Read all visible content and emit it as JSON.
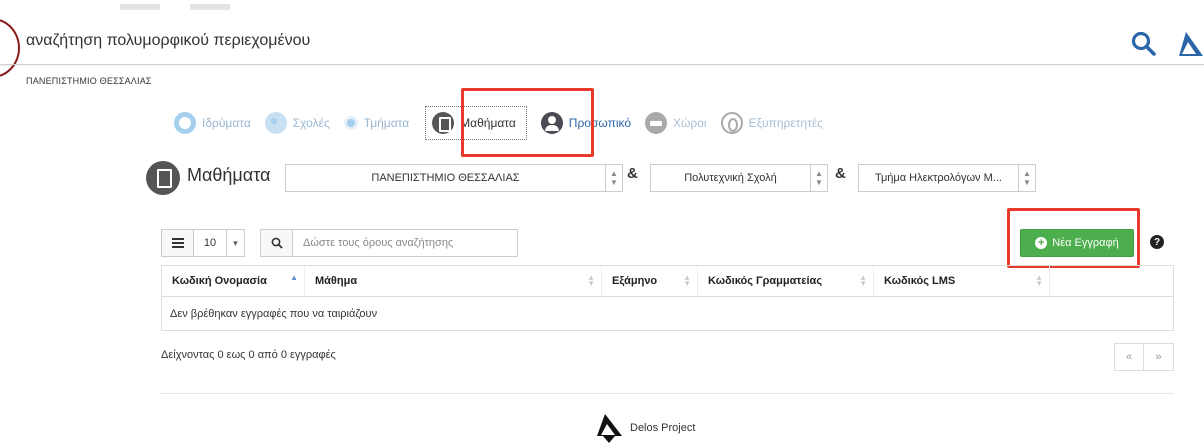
{
  "header": {
    "title": "αναζήτηση πολυμορφικού περιεχομένου",
    "university": "ΠΑΝΕΠΙΣΤΗΜΙΟ ΘΕΣΣΑΛΙΑΣ"
  },
  "nav": {
    "items": [
      {
        "label": "Ιδρύματα",
        "icon": "institution-icon"
      },
      {
        "label": "Σχολές",
        "icon": "school-icon"
      },
      {
        "label": "Τμήματα",
        "icon": "department-icon"
      },
      {
        "label": "Μαθήματα",
        "icon": "book-icon",
        "active": true
      },
      {
        "label": "Προσωπικό",
        "icon": "person-icon"
      },
      {
        "label": "Χώροι",
        "icon": "room-icon"
      },
      {
        "label": "Εξυπηρετητές",
        "icon": "server-icon"
      }
    ]
  },
  "page": {
    "title": "Μαθήματα",
    "filters": {
      "institution": "ΠΑΝΕΠΙΣΤΗΜΙΟ ΘΕΣΣΑΛΙΑΣ",
      "school": "Πολυτεχνική Σχολή",
      "department": "Τμήμα Ηλεκτρολόγων Μ..."
    },
    "amp": "&"
  },
  "toolbar": {
    "page_length": "10",
    "search_placeholder": "Δώστε τους όρους αναζήτησης",
    "new_label": "Νέα Εγγραφή",
    "help": "?"
  },
  "table": {
    "columns": [
      "Κωδική Ονομασία",
      "Μάθημα",
      "Εξάμηνο",
      "Κωδικός Γραμματείας",
      "Κωδικός LMS"
    ],
    "empty_message": "Δεν βρέθηκαν εγγραφές που να ταιριάζουν"
  },
  "footer": {
    "info": "Δείχνοντας 0 εως 0 από 0 εγγραφές",
    "prev": "«",
    "next": "»",
    "brand": "Delos Project"
  },
  "colors": {
    "accent": "#5aa8e0",
    "success": "#4cae4c",
    "highlight": "#e8392c",
    "link": "#2b67a8"
  }
}
